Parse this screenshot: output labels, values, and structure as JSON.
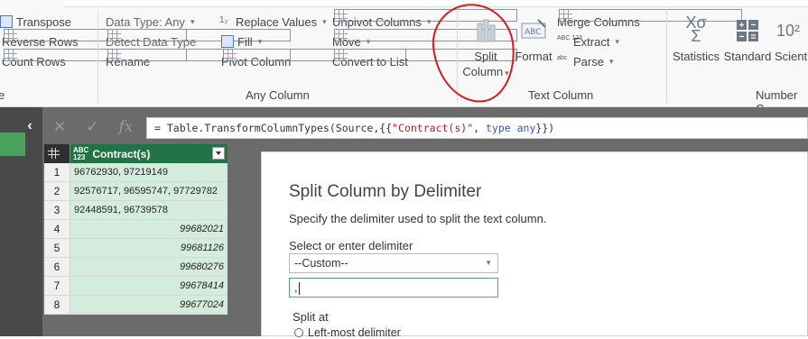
{
  "ribbon": {
    "table_group": {
      "items": [
        {
          "label": "Transpose",
          "icon": "transpose-icon"
        },
        {
          "label": "Reverse Rows",
          "icon": "reverse-rows-icon"
        },
        {
          "label": "Count Rows",
          "icon": "count-rows-icon"
        }
      ],
      "label": "e"
    },
    "any_column": {
      "label": "Any Column",
      "data_type": "Data Type: Any",
      "detect_data_type": "Detect Data Type",
      "rename": "Rename",
      "replace_values": "Replace Values",
      "fill": "Fill",
      "pivot_column": "Pivot Column",
      "unpivot_columns": "Unpivot Columns",
      "move": "Move",
      "convert_to_list": "Convert to List"
    },
    "text_column": {
      "label": "Text Column",
      "split_column_line1": "Split",
      "split_column_line2": "Column",
      "format": "Format",
      "merge_columns": "Merge Columns",
      "extract": "Extract",
      "parse": "Parse"
    },
    "number_column": {
      "label": "Number C",
      "statistics": "Statistics",
      "standard": "Standard",
      "scientific": "Scientific"
    }
  },
  "formula": {
    "prefix": "= Table.TransformColumnTypes(Source,{{",
    "string": "\"Contract(s)\"",
    "mid": ", ",
    "kw_type": "type",
    "kw_any": "any",
    "suffix": "}})"
  },
  "grid": {
    "column_header": "Contract(s)",
    "type_badge_top": "ABC",
    "type_badge_bottom": "123",
    "rows": [
      {
        "n": "1",
        "value": "96762930, 97219149",
        "numeric": false
      },
      {
        "n": "2",
        "value": "92576717, 96595747, 97729782",
        "numeric": false
      },
      {
        "n": "3",
        "value": "92448591, 96739578",
        "numeric": false
      },
      {
        "n": "4",
        "value": "99682021",
        "numeric": true
      },
      {
        "n": "5",
        "value": "99681126",
        "numeric": true
      },
      {
        "n": "6",
        "value": "99680276",
        "numeric": true
      },
      {
        "n": "7",
        "value": "99678414",
        "numeric": true
      },
      {
        "n": "8",
        "value": "99677024",
        "numeric": true
      }
    ]
  },
  "dialog": {
    "title": "Split Column by Delimiter",
    "description": "Specify the delimiter used to split the text column.",
    "delimiter_label": "Select or enter delimiter",
    "delimiter_selected": "--Custom--",
    "custom_value": ",",
    "split_at_label": "Split at",
    "option_leftmost": "Left-most delimiter"
  },
  "colors": {
    "accent_green": "#217346",
    "cell_green": "#d4ecde",
    "annotation_red": "#d21d1d"
  }
}
